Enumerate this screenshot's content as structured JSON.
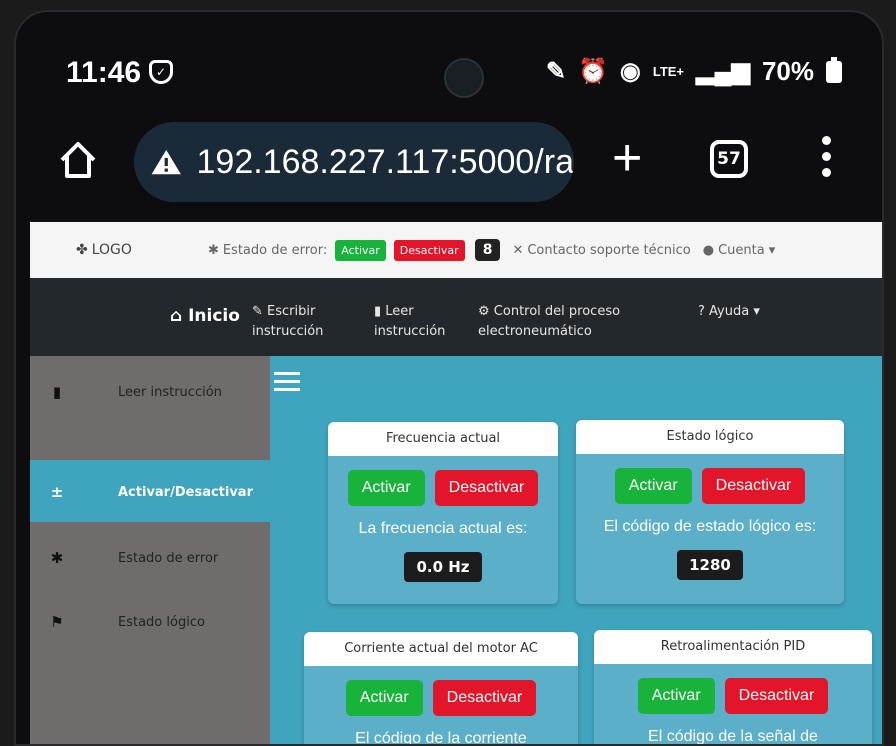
{
  "status_bar": {
    "time": "11:46",
    "network": "LTE+",
    "battery": "70%"
  },
  "browser": {
    "url": "192.168.227.117:5000/ra",
    "tab_count": "57"
  },
  "topnav": {
    "logo": "LOGO",
    "error_label": "Estado de error:",
    "activar": "Activar",
    "desactivar": "Desactivar",
    "error_count": "8",
    "support": "Contacto soporte técnico",
    "account": "Cuenta"
  },
  "mainnav": {
    "home": "Inicio",
    "write_1": "Escribir",
    "write_2": "instrucción",
    "read_1": "Leer",
    "read_2": "instrucción",
    "control_1": "Control del proceso",
    "control_2": "electroneumático",
    "help": "? Ayuda"
  },
  "sidebar": {
    "items": [
      {
        "label": "Leer instrucción",
        "icon": "file-icon"
      },
      {
        "label": "Activar/Desactivar",
        "icon": "plus-minus-icon"
      },
      {
        "label": "Estado de error",
        "icon": "bug-icon"
      },
      {
        "label": "Estado lógico",
        "icon": "flag-icon"
      }
    ]
  },
  "cards": [
    {
      "title": "Frecuencia actual",
      "activar": "Activar",
      "desactivar": "Desactivar",
      "text": "La frecuencia actual es:",
      "value": "0.0 Hz"
    },
    {
      "title": "Estado lógico",
      "activar": "Activar",
      "desactivar": "Desactivar",
      "text": "El código de estado lógico es:",
      "value": "1280"
    },
    {
      "title": "Corriente actual del motor AC",
      "activar": "Activar",
      "desactivar": "Desactivar",
      "text": "El código de la corriente"
    },
    {
      "title": "Retroalimentación PID",
      "activar": "Activar",
      "desactivar": "Desactivar",
      "text": "El código de la señal de"
    }
  ],
  "colors": {
    "green": "#18b33a",
    "red": "#e3152b",
    "content_bg": "#3fa4bd",
    "sidebar_bg": "#706c6c"
  }
}
